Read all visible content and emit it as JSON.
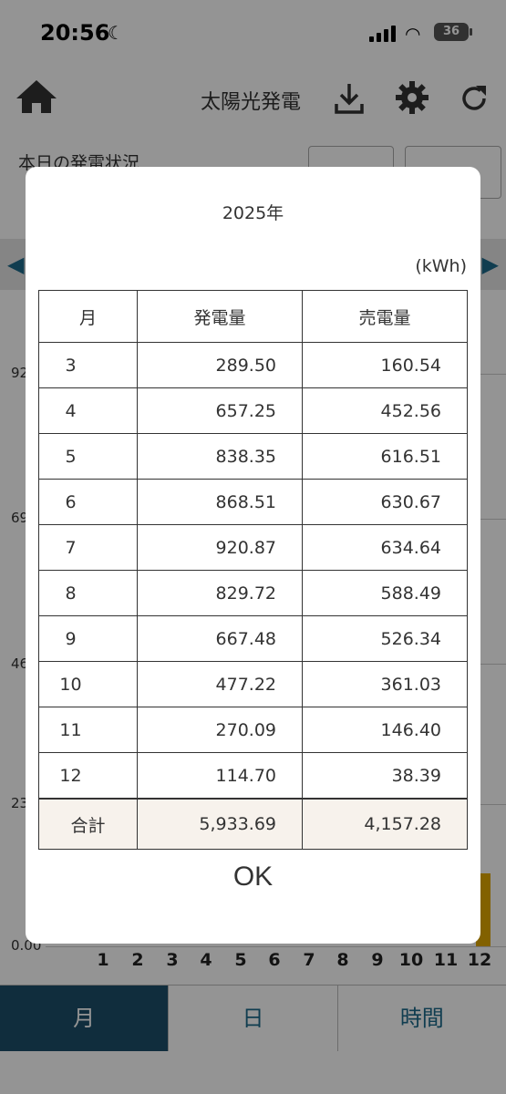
{
  "status": {
    "time": "20:56",
    "battery": "36"
  },
  "toolbar": {
    "title": "太陽光発電"
  },
  "today": {
    "label": "本日の発電状況",
    "button1": "",
    "button2": ""
  },
  "chart_bg": {
    "y_ticks": [
      "92",
      "69",
      "46",
      "23",
      "0.00"
    ],
    "x_labels": [
      "1",
      "2",
      "3",
      "4",
      "5",
      "6",
      "7",
      "8",
      "9",
      "10",
      "11",
      "12"
    ]
  },
  "tabs": [
    {
      "label": "月"
    },
    {
      "label": "日"
    },
    {
      "label": "時間"
    }
  ],
  "modal": {
    "year": "2025年",
    "unit": "(kWh)",
    "headers": {
      "month": "月",
      "generation": "発電量",
      "sold": "売電量"
    },
    "rows": [
      {
        "month": "3",
        "generation": "289.50",
        "sold": "160.54"
      },
      {
        "month": "4",
        "generation": "657.25",
        "sold": "452.56"
      },
      {
        "month": "5",
        "generation": "838.35",
        "sold": "616.51"
      },
      {
        "month": "6",
        "generation": "868.51",
        "sold": "630.67"
      },
      {
        "month": "7",
        "generation": "920.87",
        "sold": "634.64"
      },
      {
        "month": "8",
        "generation": "829.72",
        "sold": "588.49"
      },
      {
        "month": "9",
        "generation": "667.48",
        "sold": "526.34"
      },
      {
        "month": "10",
        "generation": "477.22",
        "sold": "361.03"
      },
      {
        "month": "11",
        "generation": "270.09",
        "sold": "146.40"
      },
      {
        "month": "12",
        "generation": "114.70",
        "sold": "38.39"
      }
    ],
    "total": {
      "label": "合計",
      "generation": "5,933.69",
      "sold": "4,157.28"
    },
    "ok_label": "OK"
  },
  "colors": {
    "accent": "#1c4f6a",
    "link": "#1c6a8a",
    "bar": "#e0a800",
    "total_row_bg": "#f7f2ec"
  }
}
